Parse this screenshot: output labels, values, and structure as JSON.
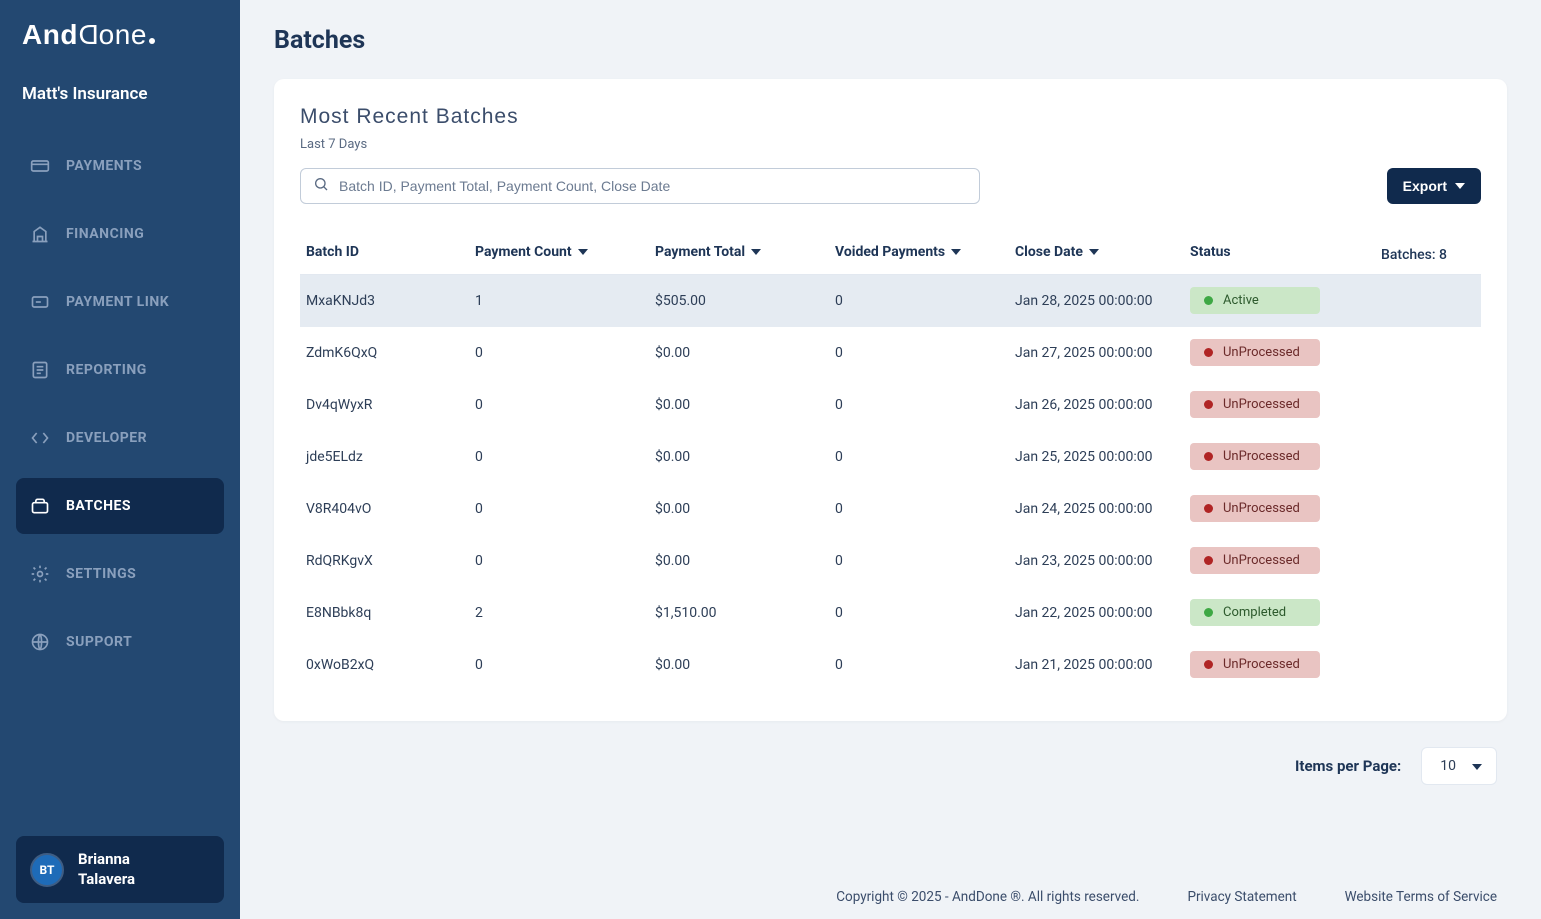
{
  "brand": "AndDone",
  "org_name": "Matt's Insurance",
  "sidebar": {
    "items": [
      {
        "label": "PAYMENTS"
      },
      {
        "label": "FINANCING"
      },
      {
        "label": "PAYMENT LINK"
      },
      {
        "label": "REPORTING"
      },
      {
        "label": "DEVELOPER"
      },
      {
        "label": "BATCHES"
      },
      {
        "label": "SETTINGS"
      },
      {
        "label": "SUPPORT"
      }
    ]
  },
  "user": {
    "initials": "BT",
    "name_line1": "Brianna",
    "name_line2": "Talavera"
  },
  "page": {
    "title": "Batches",
    "card_title": "Most Recent Batches",
    "card_sub": "Last 7 Days",
    "batch_count_label": "Batches: 8",
    "search_placeholder": "Batch ID, Payment Total, Payment Count, Close Date",
    "export_label": "Export"
  },
  "columns": {
    "batch_id": "Batch ID",
    "payment_count": "Payment Count",
    "payment_total": "Payment Total",
    "voided": "Voided Payments",
    "close_date": "Close Date",
    "status": "Status"
  },
  "rows": [
    {
      "id": "MxaKNJd3",
      "count": "1",
      "total": "$505.00",
      "void": "0",
      "date": "Jan 28, 2025 00:00:00",
      "status": "Active",
      "status_class": "active",
      "highlight": true
    },
    {
      "id": "ZdmK6QxQ",
      "count": "0",
      "total": "$0.00",
      "void": "0",
      "date": "Jan 27, 2025 00:00:00",
      "status": "UnProcessed",
      "status_class": "unprocessed"
    },
    {
      "id": "Dv4qWyxR",
      "count": "0",
      "total": "$0.00",
      "void": "0",
      "date": "Jan 26, 2025 00:00:00",
      "status": "UnProcessed",
      "status_class": "unprocessed"
    },
    {
      "id": "jde5ELdz",
      "count": "0",
      "total": "$0.00",
      "void": "0",
      "date": "Jan 25, 2025 00:00:00",
      "status": "UnProcessed",
      "status_class": "unprocessed"
    },
    {
      "id": "V8R404vO",
      "count": "0",
      "total": "$0.00",
      "void": "0",
      "date": "Jan 24, 2025 00:00:00",
      "status": "UnProcessed",
      "status_class": "unprocessed"
    },
    {
      "id": "RdQRKgvX",
      "count": "0",
      "total": "$0.00",
      "void": "0",
      "date": "Jan 23, 2025 00:00:00",
      "status": "UnProcessed",
      "status_class": "unprocessed"
    },
    {
      "id": "E8NBbk8q",
      "count": "2",
      "total": "$1,510.00",
      "void": "0",
      "date": "Jan 22, 2025 00:00:00",
      "status": "Completed",
      "status_class": "completed"
    },
    {
      "id": "0xWoB2xQ",
      "count": "0",
      "total": "$0.00",
      "void": "0",
      "date": "Jan 21, 2025 00:00:00",
      "status": "UnProcessed",
      "status_class": "unprocessed"
    }
  ],
  "pagination": {
    "label": "Items per Page:",
    "value": "10"
  },
  "footer": {
    "copyright": "Copyright © 2025 - AndDone ®. All rights reserved.",
    "privacy": "Privacy Statement",
    "tos": "Website Terms of Service"
  }
}
